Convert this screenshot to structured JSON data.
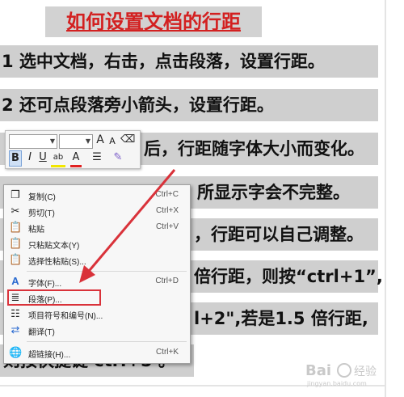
{
  "title": "如何设置文档的行距",
  "lines": {
    "l1": "1 选中文档，右击，点击段落，设置行距。",
    "l2": "2 还可点段落旁小箭头，设置行距。",
    "l3": "后，行距随字体大小而变化。",
    "l4": "所显示字会不完整。",
    "l5": "，行距可以自己调整。",
    "l6": "倍行距，则按“ctrl+1”,",
    "l7": "l+2\",若是1.5 倍行距,",
    "l8": "则按快捷键 ctrl+5 。"
  },
  "toolbar": {
    "font_a_grow": "A",
    "font_a_shrink": "A",
    "bold": "B",
    "italic": "I",
    "underline": "U",
    "highlight": "ab",
    "font_color": "A"
  },
  "menu": {
    "items": [
      {
        "label": "复制(C)",
        "shortcut": "Ctrl+C",
        "icon": "copy-icon"
      },
      {
        "label": "剪切(T)",
        "shortcut": "Ctrl+X",
        "icon": "scissors-icon"
      },
      {
        "label": "粘贴",
        "shortcut": "Ctrl+V",
        "icon": "paste-icon"
      },
      {
        "label": "只粘贴文本(Y)",
        "shortcut": "",
        "icon": "paste-text-icon"
      },
      {
        "label": "选择性粘贴(S)...",
        "shortcut": "",
        "icon": "paste-special-icon"
      },
      {
        "label": "字体(F)...",
        "shortcut": "Ctrl+D",
        "icon": "font-icon"
      },
      {
        "label": "段落(P)...",
        "shortcut": "",
        "icon": "paragraph-icon"
      },
      {
        "label": "项目符号和编号(N)...",
        "shortcut": "",
        "icon": "bullets-icon"
      },
      {
        "label": "翻译(T)",
        "shortcut": "",
        "icon": "translate-icon"
      },
      {
        "label": "超链接(H)...",
        "shortcut": "Ctrl+K",
        "icon": "hyperlink-icon"
      }
    ]
  },
  "watermark": {
    "brand": "Bai",
    "cn": "经验",
    "url": "jingyan.baidu.com"
  },
  "colors": {
    "title_red": "#d32020",
    "highlight_band": "#cfcfcf",
    "annotation_red": "#d9323a"
  }
}
